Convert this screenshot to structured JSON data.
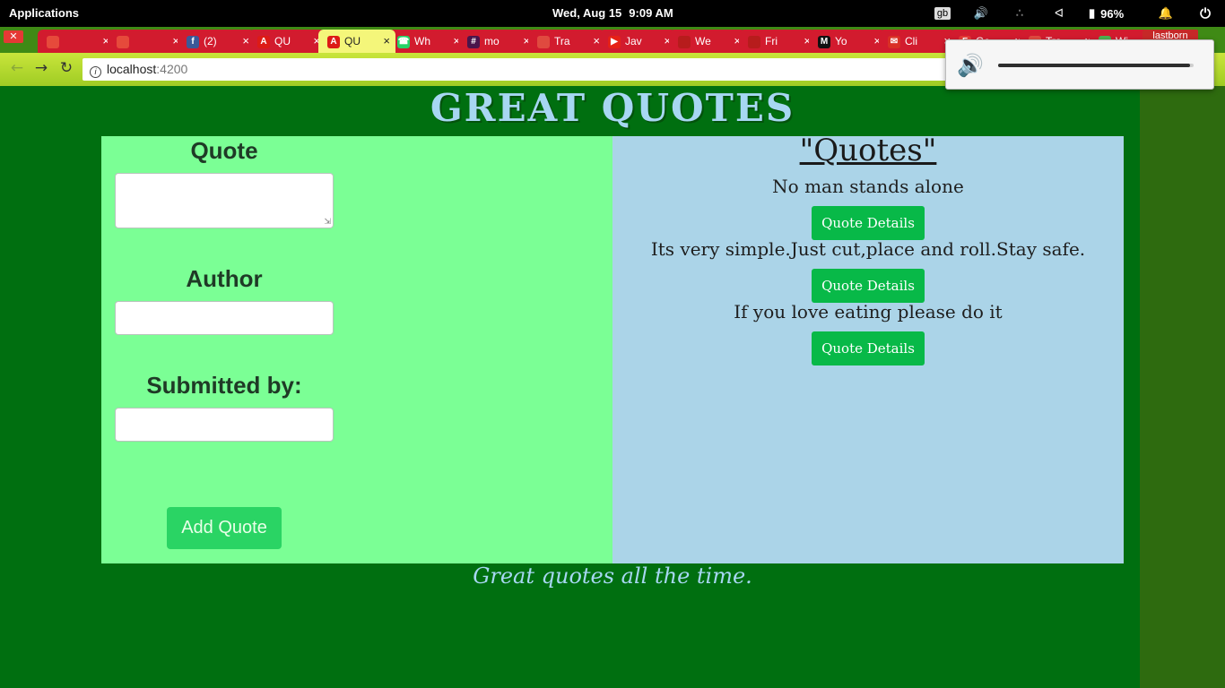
{
  "topbar": {
    "apps_label": "Applications",
    "date": "Wed, Aug 15",
    "time": "9:09 AM",
    "keyboard_layout": "gb",
    "battery": "96%"
  },
  "browser": {
    "tabs": [
      {
        "title": "",
        "icon": "pdf-icon",
        "active": false
      },
      {
        "title": "",
        "icon": "pdf-icon",
        "active": false
      },
      {
        "title": "(2)",
        "icon": "facebook-icon",
        "active": false
      },
      {
        "title": "QU",
        "icon": "angular-icon",
        "active": false
      },
      {
        "title": "QU",
        "icon": "angular-icon",
        "active": true
      },
      {
        "title": "Wh",
        "icon": "whatsapp-icon",
        "active": false
      },
      {
        "title": "mo",
        "icon": "slack-icon",
        "active": false
      },
      {
        "title": "Tra",
        "icon": "trello-icon",
        "active": false
      },
      {
        "title": "Jav",
        "icon": "youtube-icon",
        "active": false
      },
      {
        "title": "We",
        "icon": "site-icon",
        "active": false
      },
      {
        "title": "Fri",
        "icon": "site-icon",
        "active": false
      },
      {
        "title": "Yo",
        "icon": "medium-icon",
        "active": false
      },
      {
        "title": "Cli",
        "icon": "gmail-icon",
        "active": false
      },
      {
        "title": "Go",
        "icon": "flask-icon",
        "active": false
      },
      {
        "title": "Tra",
        "icon": "trello-icon",
        "active": false
      },
      {
        "title": "Wi",
        "icon": "chrome-icon",
        "active": false
      }
    ],
    "profile": "lastborn",
    "url_host": "localhost",
    "url_port": ":4200"
  },
  "volume": {
    "level": 0.98
  },
  "app": {
    "title": "GREAT QUOTES",
    "form": {
      "quote_label": "Quote",
      "quote_value": "",
      "author_label": "Author",
      "author_value": "",
      "submitted_label": "Submitted by:",
      "submitted_value": "",
      "add_button": "Add Quote"
    },
    "quotes_heading": "\"Quotes\"",
    "quotes": [
      {
        "text": "No man stands alone",
        "button": "Quote Details"
      },
      {
        "text": "Its very simple.Just cut,place and roll.Stay safe.",
        "button": "Quote Details"
      },
      {
        "text": "If you love eating please do it",
        "button": "Quote Details"
      }
    ],
    "tagline": "Great quotes all the time."
  },
  "colors": {
    "page_bg": "#006f10",
    "left_panel": "#7bff95",
    "right_panel": "#abd4e8",
    "details_button": "#08b948",
    "add_button": "#2ad464",
    "title_text": "#a7d7f2"
  }
}
